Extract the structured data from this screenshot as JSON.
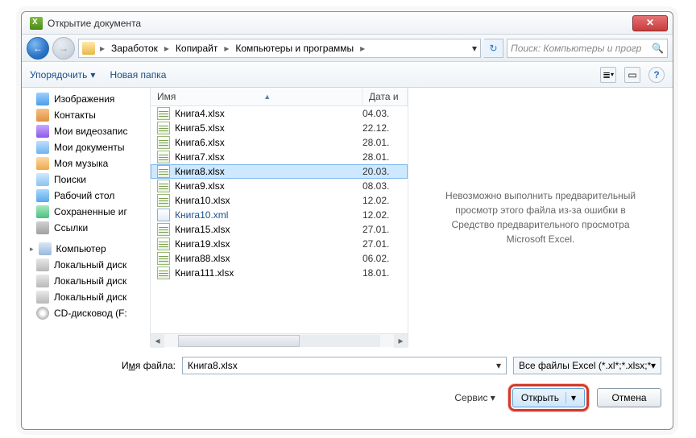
{
  "titlebar": {
    "title": "Открытие документа"
  },
  "breadcrumb": {
    "segments": [
      "Заработок",
      "Копирайт",
      "Компьютеры и программы"
    ]
  },
  "search": {
    "placeholder": "Поиск: Компьютеры и прогр"
  },
  "toolbar": {
    "organize": "Упорядочить",
    "newfolder": "Новая папка"
  },
  "sidebar": {
    "items": [
      {
        "label": "Изображения",
        "icon": "pic"
      },
      {
        "label": "Контакты",
        "icon": "contact"
      },
      {
        "label": "Мои видеозапис",
        "icon": "video"
      },
      {
        "label": "Мои документы",
        "icon": "doc"
      },
      {
        "label": "Моя музыка",
        "icon": "music"
      },
      {
        "label": "Поиски",
        "icon": "search"
      },
      {
        "label": "Рабочий стол",
        "icon": "desk"
      },
      {
        "label": "Сохраненные иг",
        "icon": "save"
      },
      {
        "label": "Ссылки",
        "icon": "link"
      }
    ],
    "computer_label": "Компьютер",
    "drives": [
      {
        "label": "Локальный диск",
        "icon": "disk"
      },
      {
        "label": "Локальный диск",
        "icon": "disk"
      },
      {
        "label": "Локальный диск",
        "icon": "disk"
      },
      {
        "label": "CD-дисковод (F:",
        "icon": "cd"
      }
    ]
  },
  "list": {
    "col_name": "Имя",
    "col_date": "Дата и",
    "rows": [
      {
        "name": "Книга4.xlsx",
        "date": "04.03.",
        "type": "xlsx"
      },
      {
        "name": "Книга5.xlsx",
        "date": "22.12.",
        "type": "xlsx"
      },
      {
        "name": "Книга6.xlsx",
        "date": "28.01.",
        "type": "xlsx"
      },
      {
        "name": "Книга7.xlsx",
        "date": "28.01.",
        "type": "xlsx"
      },
      {
        "name": "Книга8.xlsx",
        "date": "20.03.",
        "type": "xlsx",
        "selected": true
      },
      {
        "name": "Книга9.xlsx",
        "date": "08.03.",
        "type": "xlsx"
      },
      {
        "name": "Книга10.xlsx",
        "date": "12.02.",
        "type": "xlsx"
      },
      {
        "name": "Книга10.xml",
        "date": "12.02.",
        "type": "xml"
      },
      {
        "name": "Книга15.xlsx",
        "date": "27.01.",
        "type": "xlsx"
      },
      {
        "name": "Книга19.xlsx",
        "date": "27.01.",
        "type": "xlsx"
      },
      {
        "name": "Книга88.xlsx",
        "date": "06.02.",
        "type": "xlsx"
      },
      {
        "name": "Книга111.xlsx",
        "date": "18.01.",
        "type": "xlsx"
      }
    ]
  },
  "preview": {
    "message": "Невозможно выполнить предварительный просмотр этого файла из-за ошибки в Средство предварительного просмотра Microsoft Excel."
  },
  "footer": {
    "filename_label_pre": "И",
    "filename_label_u": "м",
    "filename_label_post": "я файла:",
    "filename_value": "Книга8.xlsx",
    "filter": "Все файлы Excel (*.xl*;*.xlsx;*.xl",
    "service": "Сервис",
    "open": "Открыть",
    "cancel": "Отмена"
  }
}
